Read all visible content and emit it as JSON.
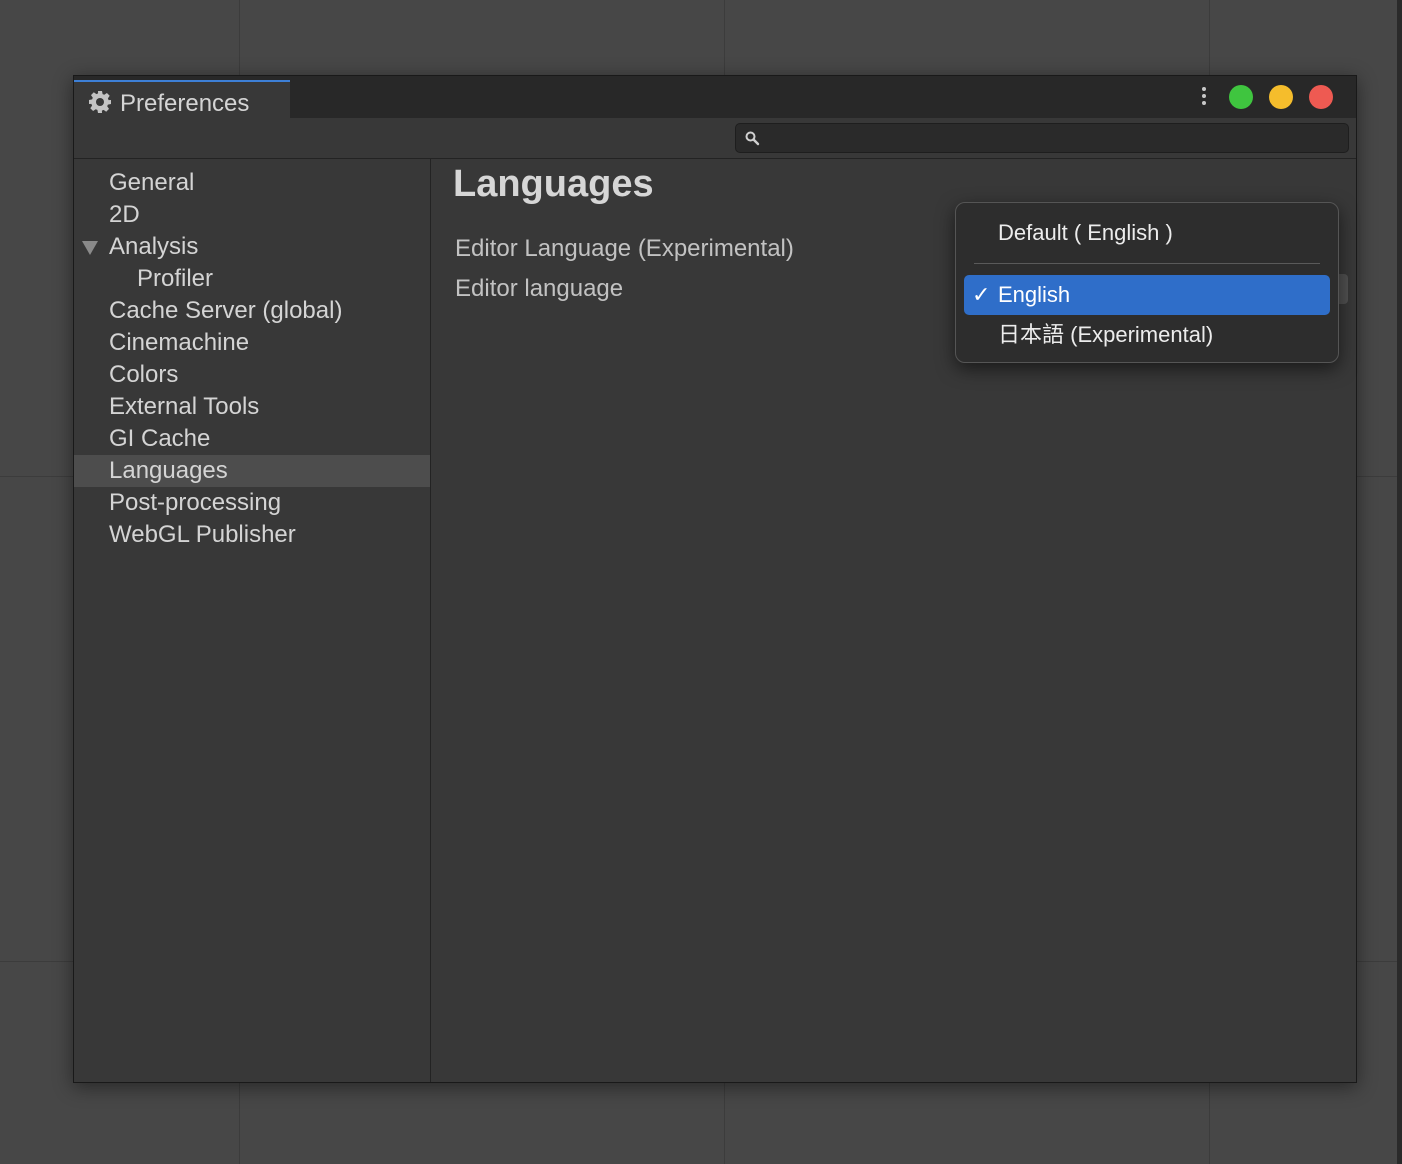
{
  "window": {
    "title": "Preferences",
    "search": {
      "value": "",
      "placeholder": ""
    }
  },
  "colors": {
    "accent_tab": "#3d7fd6",
    "traffic_green": "#3fc53f",
    "traffic_yellow": "#f5bd2c",
    "traffic_red": "#ee5a52",
    "selection_highlight": "#2f6ec9"
  },
  "sidebar": {
    "items": [
      {
        "label": "General"
      },
      {
        "label": "2D"
      },
      {
        "label": "Analysis",
        "expanded": true
      },
      {
        "label": "Profiler",
        "child": true
      },
      {
        "label": "Cache Server (global)"
      },
      {
        "label": "Cinemachine"
      },
      {
        "label": "Colors"
      },
      {
        "label": "External Tools"
      },
      {
        "label": "GI Cache"
      },
      {
        "label": "Languages",
        "selected": true
      },
      {
        "label": "Post-processing"
      },
      {
        "label": "WebGL Publisher"
      }
    ]
  },
  "main": {
    "title": "Languages",
    "fields": [
      {
        "label": "Editor Language (Experimental)"
      },
      {
        "label": "Editor language"
      }
    ]
  },
  "dropdown": {
    "options": [
      {
        "label": "Default ( English )"
      },
      {
        "label": "English",
        "checked": true
      },
      {
        "label": "日本語 (Experimental)"
      }
    ],
    "check_glyph": "✓"
  }
}
